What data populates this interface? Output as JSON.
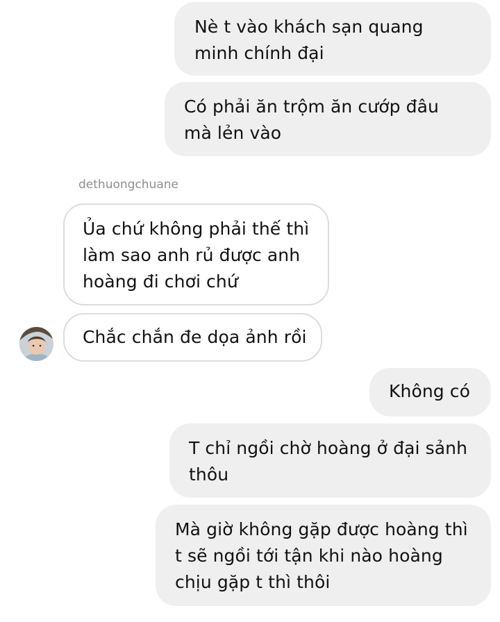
{
  "messages": [
    {
      "direction": "outgoing",
      "text": "Nè t vào khách sạn quang minh chính đại"
    },
    {
      "direction": "outgoing",
      "text": "Có phải ăn trộm ăn cướp đâu mà lẻn vào"
    },
    {
      "direction": "incoming",
      "sender": "dethuongchuane",
      "text": "Ủa chứ không phải thế thì làm sao anh rủ được anh hoàng đi chơi chứ"
    },
    {
      "direction": "incoming",
      "text": "Chắc chắn đe dọa ảnh rồi"
    },
    {
      "direction": "outgoing",
      "text": "Không có"
    },
    {
      "direction": "outgoing",
      "text": "T chỉ ngồi chờ hoàng ở đại sảnh thôu"
    },
    {
      "direction": "outgoing",
      "text": "Mà giờ không gặp được hoàng thì t sẽ ngồi tới tận khi nào hoàng chịu gặp t thì thôi"
    }
  ],
  "colors": {
    "outgoing_bubble": "#efefef",
    "incoming_border": "#dcdcdc",
    "sender_name": "#8e8e8e",
    "text": "#111111"
  }
}
